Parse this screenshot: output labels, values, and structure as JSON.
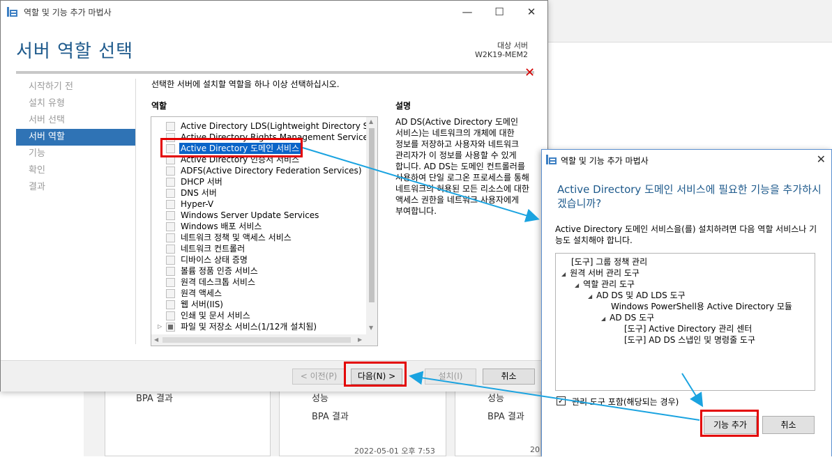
{
  "background": {
    "tiles": [
      {
        "items": [
          "BPA 결과"
        ]
      },
      {
        "items": [
          "성능",
          "BPA 결과"
        ]
      },
      {
        "items": [
          "성능",
          "BPA 결과"
        ]
      }
    ],
    "timestamp": "2022-05-01 오후 7:53",
    "timestamp_cut": "20"
  },
  "wizard": {
    "window_title": "역할 및 기능 추가 마법사",
    "minimize": "—",
    "maximize": "☐",
    "close": "✕",
    "page_title": "서버 역할 선택",
    "target_label": "대상 서버",
    "target_server": "W2K19-MEM2",
    "red_x": "✕",
    "nav": [
      {
        "label": "시작하기 전",
        "active": false
      },
      {
        "label": "설치 유형",
        "active": false
      },
      {
        "label": "서버 선택",
        "active": false
      },
      {
        "label": "서버 역할",
        "active": true
      },
      {
        "label": "기능",
        "active": false
      },
      {
        "label": "확인",
        "active": false
      },
      {
        "label": "결과",
        "active": false
      }
    ],
    "instruction": "선택한 서버에 설치할 역할을 하나 이상 선택하십시오.",
    "roles_heading": "역할",
    "description_heading": "설명",
    "roles": [
      "Active Directory LDS(Lightweight Directory Services)",
      "Active Directory Rights Management Services",
      "Active Directory 도메인 서비스",
      "Active Directory 인증서 서비스",
      "ADFS(Active Directory Federation Services)",
      "DHCP 서버",
      "DNS 서버",
      "Hyper-V",
      "Windows Server Update Services",
      "Windows 배포 서비스",
      "네트워크 정책 및 액세스 서비스",
      "네트워크 컨트롤러",
      "디바이스 상태 증명",
      "볼륨 정품 인증 서비스",
      "원격 데스크톱 서비스",
      "원격 액세스",
      "웹 서버(IIS)",
      "인쇄 및 문서 서비스",
      "파일 및 저장소 서비스(1/12개 설치됨)"
    ],
    "selected_role_index": 2,
    "description": "AD DS(Active Directory 도메인 서비스)는 네트워크의 개체에 대한 정보를 저장하고 사용자와 네트워크 관리자가 이 정보를 사용할 수 있게 합니다. AD DS는 도메인 컨트롤러를 사용하여 단일 로그온 프로세스를 통해 네트워크의 허용된 모든 리소스에 대한 액세스 권한을 네트워크 사용자에게 부여합니다.",
    "buttons": {
      "prev": "< 이전(P)",
      "next": "다음(N) >",
      "install": "설치(I)",
      "cancel": "취소"
    }
  },
  "dialog": {
    "title": "역할 및 기능 추가 마법사",
    "close": "✕",
    "heading": "Active Directory 도메인 서비스에 필요한 기능을 추가하시겠습니까?",
    "text": "Active Directory 도메인 서비스을(를) 설치하려면 다음 역할 서비스나 기능도 설치해야 합니다.",
    "tree": [
      {
        "label": "[도구] 그룹 정책 관리",
        "level": 0,
        "expanded": false
      },
      {
        "label": "원격 서버 관리 도구",
        "level": 0,
        "expanded": true
      },
      {
        "label": "역할 관리 도구",
        "level": 1,
        "expanded": true
      },
      {
        "label": "AD DS 및 AD LDS 도구",
        "level": 2,
        "expanded": true
      },
      {
        "label": "Windows PowerShell용 Active Directory 모듈",
        "level": 3,
        "expanded": false
      },
      {
        "label": "AD DS 도구",
        "level": 3,
        "expanded": true
      },
      {
        "label": "[도구] Active Directory 관리 센터",
        "level": 4,
        "expanded": false
      },
      {
        "label": "[도구] AD DS 스냅인 및 명령줄 도구",
        "level": 4,
        "expanded": false
      }
    ],
    "include_label": "관리 도구 포함(해당되는 경우)",
    "include_checked": true,
    "check_mark": "✓",
    "buttons": {
      "add": "기능 추가",
      "cancel": "취소"
    }
  },
  "colors": {
    "accent": "#1e5a8c",
    "nav_active": "#2f73b5",
    "highlight_box": "#e30000",
    "arrow": "#1aa3e0"
  }
}
